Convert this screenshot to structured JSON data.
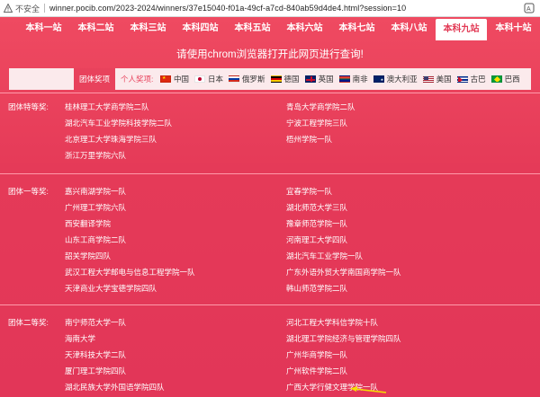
{
  "browser": {
    "insecure_label": "不安全",
    "url": "winner.pocib.com/2023-2024/winners/37e15040-f01a-49cf-a7cd-840ab59d4de4.html?session=10"
  },
  "nav": {
    "tabs": [
      "本科一站",
      "本科二站",
      "本科三站",
      "本科四站",
      "本科五站",
      "本科六站",
      "本科七站",
      "本科八站",
      "本科九站",
      "本科十站"
    ],
    "active_index": 8
  },
  "notice": "请使用chrom浏览器打开此网页进行查询!",
  "legend": {
    "team_award": "团体奖项",
    "personal_award": "个人奖项:",
    "countries": [
      "中国",
      "日本",
      "俄罗斯",
      "德国",
      "英国",
      "南非",
      "澳大利亚",
      "美国",
      "古巴",
      "巴西"
    ]
  },
  "groups": [
    {
      "label": "团体特等奖:",
      "left": [
        "桂林理工大学商学院二队",
        "湖北汽车工业学院科技学院二队",
        "北京理工大学珠海学院三队",
        "浙江万里学院六队"
      ],
      "right": [
        "青岛大学商学院二队",
        "宁波工程学院三队",
        "梧州学院一队"
      ]
    },
    {
      "label": "团体一等奖:",
      "left": [
        "嘉兴南湖学院一队",
        "广州理工学院六队",
        "西安翻译学院",
        "山东工商学院二队",
        "韶关学院四队",
        "武汉工程大学邮电与信息工程学院一队",
        "天津商业大学宝德学院四队"
      ],
      "right": [
        "宜春学院一队",
        "湖北师范大学三队",
        "豫章师范学院一队",
        "河南理工大学四队",
        "湖北汽车工业学院一队",
        "广东外语外贸大学南国商学院一队",
        "韩山师范学院二队"
      ]
    },
    {
      "label": "团体二等奖:",
      "left": [
        "南宁师范大学一队",
        "海南大学",
        "天津科技大学二队",
        "厦门理工学院四队",
        "湖北民族大学外国语学院四队"
      ],
      "right": [
        "河北工程大学科信学院十队",
        "湖北理工学院经济与管理学院四队",
        "广州华商学院一队",
        "广州软件学院二队",
        "广西大学行健文理学院一队"
      ]
    }
  ],
  "colors": {
    "accent": "#e8425c",
    "highlight_arrow": "#f5e000"
  }
}
